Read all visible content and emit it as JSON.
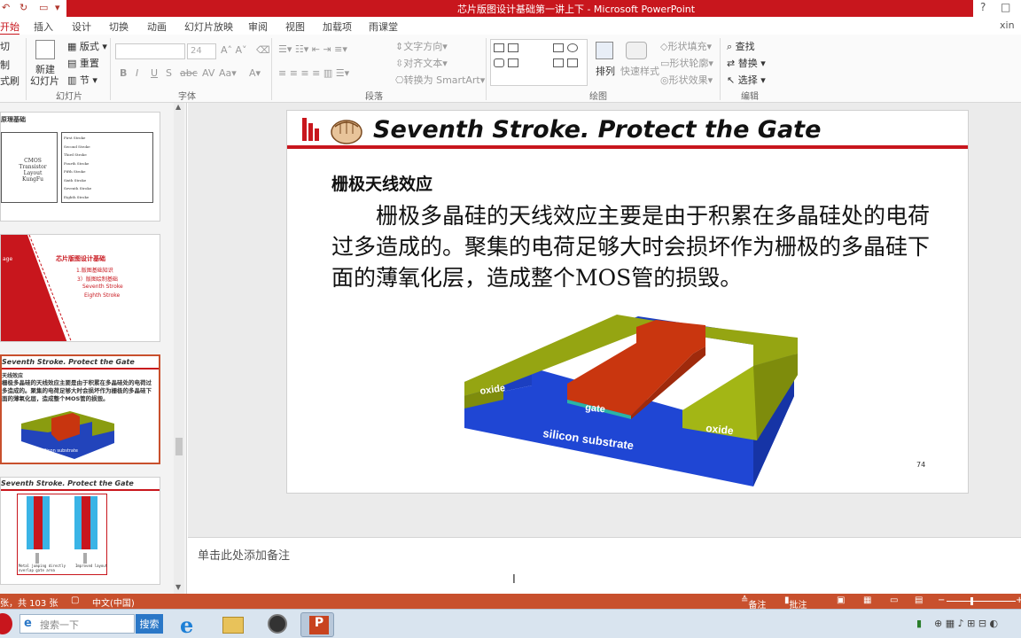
{
  "window": {
    "title": "芯片版图设计基础第一讲上下 -  Microsoft PowerPoint",
    "help_label": "?",
    "restore_label": "□",
    "close_label": "✕",
    "user": "xin",
    "brand_color": "#c8161d"
  },
  "tabs": [
    "开始",
    "插入",
    "设计",
    "切换",
    "动画",
    "幻灯片放映",
    "审阅",
    "视图",
    "加载项",
    "雨课堂"
  ],
  "active_tab": "开始",
  "ribbon": {
    "clipboard": {
      "cut": "切",
      "copy": "制",
      "format": "式刷"
    },
    "slides": {
      "group": "幻灯片",
      "new_slide": "新建",
      "new_slide2": "幻灯片",
      "layout": "版式",
      "reset": "重置",
      "section": "节"
    },
    "font": {
      "group": "字体",
      "font_size": "24"
    },
    "paragraph": {
      "group": "段落",
      "text_direction": "文字方向",
      "align_text": "对齐文本",
      "smartart": "转换为 SmartArt"
    },
    "drawing": {
      "group": "绘图",
      "arrange": "排列",
      "quick_styles": "快速样式",
      "shape_fill": "形状填充",
      "shape_outline": "形状轮廓",
      "shape_effects": "形状效果"
    },
    "editing": {
      "group": "编辑",
      "find": "查找",
      "replace": "替换",
      "select": "选择"
    }
  },
  "thumbnails": [
    {
      "label": "原理基础",
      "table": [
        "First Stroke",
        "Second Stroke",
        "Third Stroke",
        "Fourth Stroke",
        "Fifth Stroke",
        "Sixth Stroke",
        "Seventh Stroke",
        "Eighth Stroke"
      ],
      "side": "CMOS Transistor Layout KungFu"
    },
    {
      "label": "芯片版图设计基础",
      "lines": [
        "1.版图基础知识",
        "3）版图绘制基础",
        "Seventh Stroke",
        "Eighth  Stroke"
      ],
      "left": "age"
    },
    {
      "title": "Seventh Stroke.  Protect the Gate",
      "sub": "天线效应",
      "body": "栅极多晶硅的天线效应主要是由于积累在多晶硅处的电荷过多造成的。聚集的电荷足够大时会损坏作为栅极的多晶硅下面的薄氧化层，造成整个MOS管的损毁。",
      "caption": "silicon substrate"
    },
    {
      "title": "Seventh Stroke.  Protect the Gate",
      "caption1": "Metal jumping directly overlap gate area",
      "caption2": "Improved layout"
    }
  ],
  "slide": {
    "title": "Seventh Stroke.  Protect the Gate",
    "subtitle": "栅极天线效应",
    "body": "栅极多晶硅的天线效应主要是由于积累在多晶硅处的电荷过多造成的。聚集的电荷足够大时会损坏作为栅极的多晶硅下面的薄氧化层，造成整个MOS管的损毁。",
    "figure": {
      "oxide_left": "oxide",
      "oxide_right": "oxide",
      "gate": "gate",
      "substrate": "silicon substrate"
    },
    "page_number": "74"
  },
  "notes_placeholder": "单击此处添加备注",
  "status": {
    "slide_count": "张，共 103 张",
    "language": "中文(中国)",
    "notes_btn": "备注",
    "comments_btn": "批注"
  },
  "taskbar": {
    "search_placeholder": "搜索一下",
    "search_button": "搜索"
  }
}
